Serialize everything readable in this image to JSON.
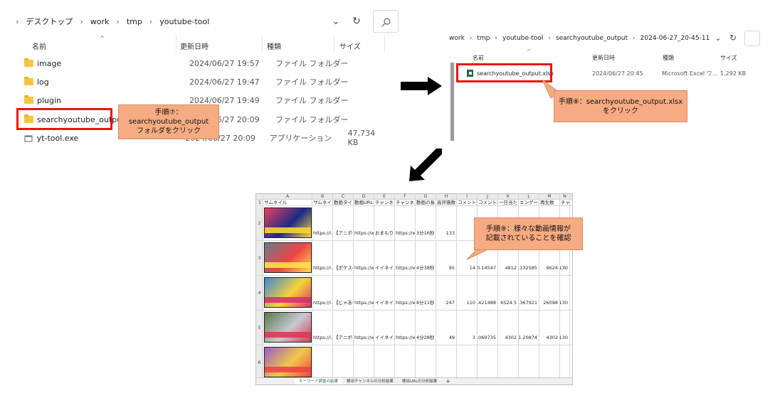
{
  "explorer1": {
    "breadcrumb": [
      "デスクトップ",
      "work",
      "tmp",
      "youtube-tool"
    ],
    "columns": {
      "name": "名前",
      "date": "更新日時",
      "type": "種類",
      "size": "サイズ"
    },
    "items": [
      {
        "name": "image",
        "date": "2024/06/27 19:57",
        "type": "ファイル フォルダー",
        "size": ""
      },
      {
        "name": "log",
        "date": "2024/06/27 19:47",
        "type": "ファイル フォルダー",
        "size": ""
      },
      {
        "name": "plugin",
        "date": "2024/06/27 19:49",
        "type": "ファイル フォルダー",
        "size": ""
      },
      {
        "name": "searchyoutube_output",
        "date": "2024/06/27 20:09",
        "type": "ファイル フォルダー",
        "size": ""
      },
      {
        "name": "yt-tool.exe",
        "date": "2024/06/27 20:09",
        "type": "アプリケーション",
        "size": "47,734 KB"
      }
    ],
    "callout": [
      "手順⑦：",
      "searchyoutube_output",
      "フォルダをクリック"
    ]
  },
  "explorer2": {
    "breadcrumb": [
      "work",
      "tmp",
      "youtube-tool",
      "searchyoutube_output",
      "2024-06-27_20-45-11"
    ],
    "columns": {
      "name": "名前",
      "date": "更新日時",
      "type": "種類",
      "size": "サイズ"
    },
    "file": {
      "name": "searchyoutube_output.xlsx",
      "date": "2024/06/27 20:45",
      "type": "Microsoft Excel ワ...",
      "size": "1,292 KB"
    },
    "callout": [
      "手順⑧：searchyoutube_output.xlsx",
      "をクリック"
    ]
  },
  "sheet": {
    "col_letters": [
      "A",
      "B",
      "C",
      "D",
      "E",
      "F",
      "G",
      "H",
      "I",
      "J",
      "K",
      "L",
      "M",
      "N"
    ],
    "headers": [
      "サムネイル",
      "サムネイル",
      "動画タイト",
      "動画URL",
      "チャンネル",
      "チャンネル",
      "動画の長さ",
      "高評価数",
      "コメント数",
      "コメント率",
      "一日当たり",
      "エンゲージ",
      "再生数",
      "チャ"
    ],
    "row_numbers": [
      "1",
      "2",
      "3",
      "4",
      "5",
      "6"
    ],
    "rows": [
      [
        "",
        "https://i.y",
        "【アニポケ",
        "https://ww",
        "おまもりこ",
        "https://ww",
        "3分16秒",
        "133",
        "",
        "",
        "",
        "",
        "",
        ""
      ],
      [
        "",
        "https://i.y",
        "【ポケスペ",
        "https://ww",
        "イイネイス",
        "https://ww",
        "4分38秒",
        "95",
        "14",
        "0.14547",
        "4812",
        "1.132585",
        "9624",
        "2130"
      ],
      [
        "",
        "https://i.y",
        "【じゃあ俺",
        "https://ww",
        "イイネイス",
        "https://ww",
        "8分11秒",
        "247",
        "110",
        "0.421488",
        "6524.5",
        "1.367921",
        "26098",
        "2130"
      ],
      [
        "",
        "https://i.y",
        "【アニポケ",
        "https://ww",
        "イイネイス",
        "https://ww",
        "4分28秒",
        "49",
        "3",
        "0.069735",
        "4302",
        "1.20874",
        "4302",
        "2130"
      ],
      [
        "",
        "",
        "",
        "",
        "",
        "",
        "",
        "",
        "",
        "",
        "",
        "",
        "",
        ""
      ]
    ],
    "tabs": [
      "キーワード調査の結果",
      "検出チャンネルの分析結果",
      "検出URLの分析結果"
    ],
    "add_tab": "+",
    "callout": [
      "手順⑨：様々な動画情報が",
      "記載されていることを確認"
    ]
  },
  "colors": {
    "red": "#ee1111",
    "callout": "#f6ab82",
    "arrow": "#000000",
    "excel_green": "#1d6f3b"
  }
}
